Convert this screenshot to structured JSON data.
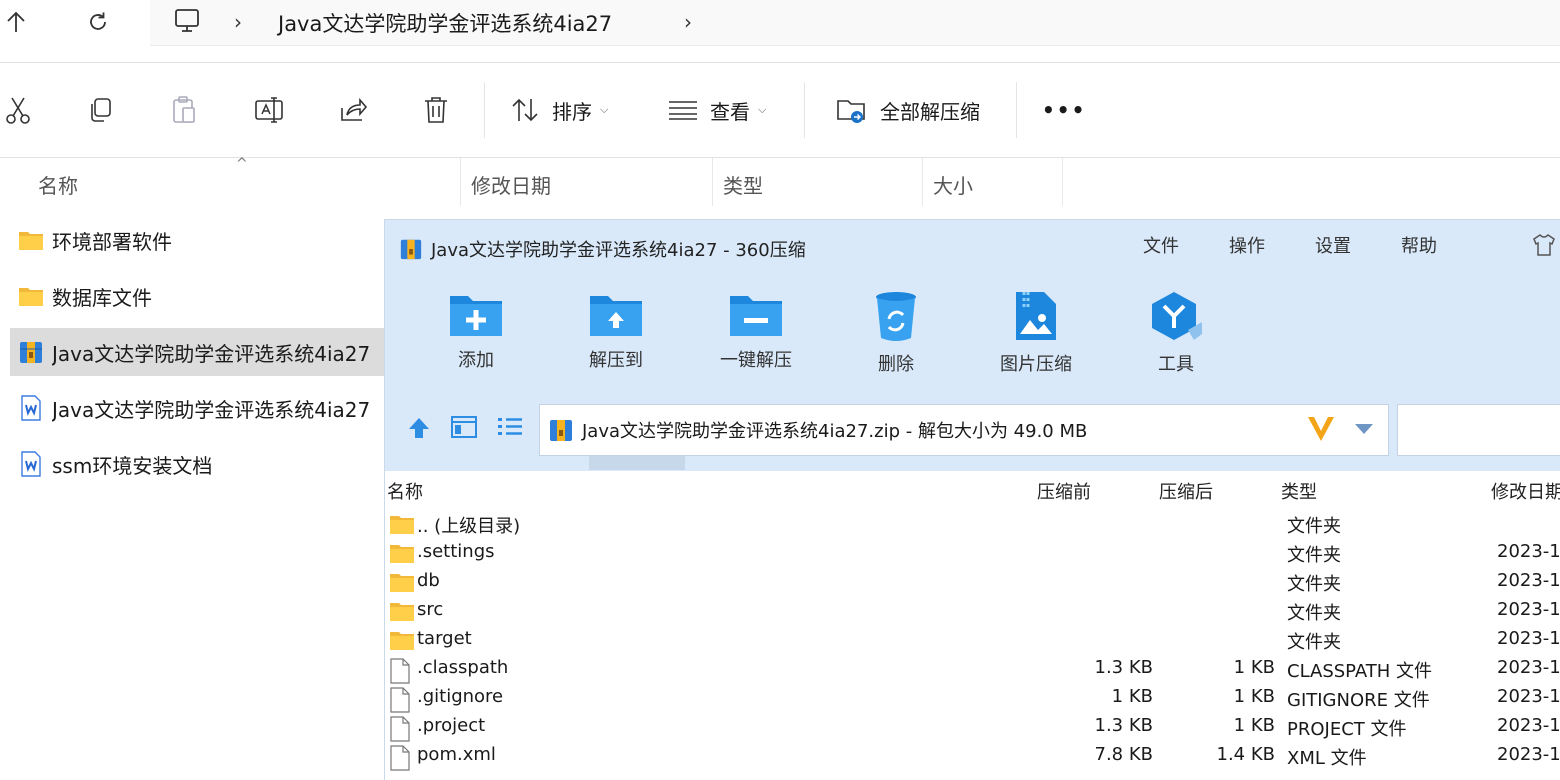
{
  "explorer": {
    "nav": {
      "breadcrumb": "Java文达学院助学金评选系统4ia27"
    },
    "toolbar": {
      "sort_label": "排序",
      "view_label": "查看",
      "extract_all_label": "全部解压缩",
      "more_label": "•••"
    },
    "columns": {
      "name": "名称",
      "modified": "修改日期",
      "type": "类型",
      "size": "大小"
    },
    "files": [
      {
        "name": "环境部署软件",
        "icon": "folder-icon"
      },
      {
        "name": "数据库文件",
        "icon": "folder-icon"
      },
      {
        "name": "Java文达学院助学金评选系统4ia27",
        "icon": "zip-archive-icon",
        "selected": true
      },
      {
        "name": "Java文达学院助学金评选系统4ia27",
        "icon": "word-doc-icon"
      },
      {
        "name": "ssm环境安装文档",
        "icon": "word-doc-icon"
      }
    ]
  },
  "zip360": {
    "title": "Java文达学院助学金评选系统4ia27 - 360压缩",
    "menu": [
      "文件",
      "操作",
      "设置",
      "帮助"
    ],
    "tools": [
      {
        "label": "添加",
        "icon": "add-folder-icon"
      },
      {
        "label": "解压到",
        "icon": "extract-to-icon"
      },
      {
        "label": "一键解压",
        "icon": "one-click-extract-icon"
      },
      {
        "label": "删除",
        "icon": "recycle-bin-icon"
      },
      {
        "label": "图片压缩",
        "icon": "image-compress-icon"
      },
      {
        "label": "工具",
        "icon": "tools-icon"
      }
    ],
    "path": "Java文达学院助学金评选系统4ia27.zip - 解包大小为 49.0 MB",
    "list_headers": {
      "name": "名称",
      "before": "压缩前",
      "after": "压缩后",
      "type": "类型",
      "modified": "修改日期"
    },
    "rows": [
      {
        "name": ".. (上级目录)",
        "before": "",
        "after": "",
        "type": "文件夹",
        "date": "",
        "icon": "folder-icon"
      },
      {
        "name": ".settings",
        "before": "",
        "after": "",
        "type": "文件夹",
        "date": "2023-1",
        "icon": "folder-icon"
      },
      {
        "name": "db",
        "before": "",
        "after": "",
        "type": "文件夹",
        "date": "2023-1",
        "icon": "folder-icon"
      },
      {
        "name": "src",
        "before": "",
        "after": "",
        "type": "文件夹",
        "date": "2023-1",
        "icon": "folder-icon"
      },
      {
        "name": "target",
        "before": "",
        "after": "",
        "type": "文件夹",
        "date": "2023-1",
        "icon": "folder-icon"
      },
      {
        "name": ".classpath",
        "before": "1.3 KB",
        "after": "1 KB",
        "type": "CLASSPATH 文件",
        "date": "2023-1",
        "icon": "file-icon"
      },
      {
        "name": ".gitignore",
        "before": "1 KB",
        "after": "1 KB",
        "type": "GITIGNORE 文件",
        "date": "2023-1",
        "icon": "file-icon"
      },
      {
        "name": ".project",
        "before": "1.3 KB",
        "after": "1 KB",
        "type": "PROJECT 文件",
        "date": "2023-1",
        "icon": "file-icon"
      },
      {
        "name": "pom.xml",
        "before": "7.8 KB",
        "after": "1.4 KB",
        "type": "XML 文件",
        "date": "2023-1",
        "icon": "file-icon"
      }
    ]
  }
}
